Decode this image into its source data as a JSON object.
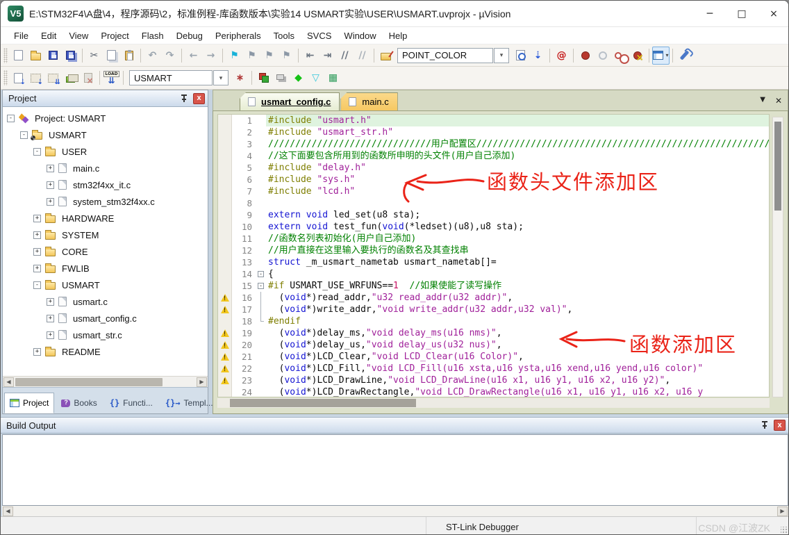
{
  "window": {
    "icon": "V5",
    "title": "E:\\STM32F4\\A盘\\4，程序源码\\2，标准例程-库函数版本\\实验14 USMART实验\\USER\\USMART.uvprojx - µVision",
    "controls": {
      "minimize": "─",
      "maximize": "□",
      "close": "×"
    }
  },
  "menu": {
    "items": [
      "File",
      "Edit",
      "View",
      "Project",
      "Flash",
      "Debug",
      "Peripherals",
      "Tools",
      "SVCS",
      "Window",
      "Help"
    ]
  },
  "toolbar_main": {
    "find_value": "POINT_COLOR",
    "items": [
      {
        "t": "i",
        "n": "new-file",
        "s": "s-page"
      },
      {
        "t": "i",
        "n": "open-file",
        "s": "s-folder"
      },
      {
        "t": "i",
        "n": "save",
        "s": "s-disk"
      },
      {
        "t": "i",
        "n": "save-all",
        "s": "s-disk s-disks"
      },
      {
        "t": "sep"
      },
      {
        "t": "i",
        "n": "cut",
        "g": "✂",
        "c": "#5a6470"
      },
      {
        "t": "i",
        "n": "copy",
        "s": "s-page s-copy"
      },
      {
        "t": "i",
        "n": "paste",
        "s": "s-clip"
      },
      {
        "t": "sep"
      },
      {
        "t": "i",
        "n": "undo",
        "g": "↶",
        "c": "#9aa4ae"
      },
      {
        "t": "i",
        "n": "redo",
        "g": "↷",
        "c": "#9aa4ae"
      },
      {
        "t": "sep"
      },
      {
        "t": "i",
        "n": "navigate-back",
        "g": "←",
        "c": "#9aa4ae"
      },
      {
        "t": "i",
        "n": "navigate-forward",
        "g": "→",
        "c": "#9aa4ae"
      },
      {
        "t": "sep"
      },
      {
        "t": "i",
        "n": "insert-bookmark",
        "g": "⚑",
        "c": "#18b2d8"
      },
      {
        "t": "i",
        "n": "next-bookmark",
        "g": "⚑",
        "c": "#8c98a6"
      },
      {
        "t": "i",
        "n": "previous-bookmark",
        "g": "⚑",
        "c": "#8c98a6"
      },
      {
        "t": "i",
        "n": "clear-bookmarks",
        "g": "⚑",
        "c": "#8c98a6"
      },
      {
        "t": "sep"
      },
      {
        "t": "i",
        "n": "unindent",
        "g": "⇤",
        "c": "#68727e"
      },
      {
        "t": "i",
        "n": "indent",
        "g": "⇥",
        "c": "#68727e"
      },
      {
        "t": "i",
        "n": "comment-selection",
        "g": "//",
        "c": "#68727e"
      },
      {
        "t": "i",
        "n": "uncomment-selection",
        "g": "//",
        "c": "#a8b0b8"
      },
      {
        "t": "sep"
      },
      {
        "t": "i",
        "n": "find-in-files",
        "s": "s-book"
      },
      {
        "t": "find"
      },
      {
        "t": "dd",
        "n": "find-dropdown"
      },
      {
        "t": "i",
        "n": "find-in-files-dialog",
        "s": "s-findpage"
      },
      {
        "t": "i",
        "n": "incremental-find",
        "g": "⇣",
        "c": "#2858d8"
      },
      {
        "t": "sep"
      },
      {
        "t": "i",
        "n": "find-text",
        "g": "@",
        "c": "#c41818"
      },
      {
        "t": "sep"
      },
      {
        "t": "i",
        "n": "insert-breakpoint",
        "s": "s-bp"
      },
      {
        "t": "i",
        "n": "enable-disable-breakpoint",
        "s": "s-bpo"
      },
      {
        "t": "i",
        "n": "disable-all-breakpoints",
        "s": "s-bp2"
      },
      {
        "t": "i",
        "n": "kill-all-breakpoints",
        "s": "s-bpx"
      },
      {
        "t": "sep"
      },
      {
        "t": "i",
        "n": "window-views",
        "s": "s-win",
        "pressed": true,
        "dd": true
      },
      {
        "t": "sep"
      },
      {
        "t": "i",
        "n": "configure",
        "s": "s-wrench"
      }
    ]
  },
  "toolbar_build": {
    "target_value": "USMART",
    "items": [
      {
        "t": "i",
        "n": "translate",
        "s": "s-page",
        "ov": "⇣",
        "oc": "#2858d8"
      },
      {
        "t": "i",
        "n": "build",
        "s": "s-build",
        "ov": "⇣",
        "oc": "#2858d8"
      },
      {
        "t": "i",
        "n": "rebuild-all",
        "s": "s-build",
        "ov": "⇊",
        "oc": "#2858d8"
      },
      {
        "t": "i",
        "n": "batch-build",
        "s": "s-batch"
      },
      {
        "t": "i",
        "n": "stop-build",
        "s": "s-stop"
      },
      {
        "t": "sep"
      },
      {
        "t": "i",
        "n": "download",
        "s": "s-load",
        "g": "⇊",
        "c": "#2353c4",
        "lbl": "LOAD"
      },
      {
        "t": "sep"
      },
      {
        "t": "target"
      },
      {
        "t": "dd",
        "n": "target-dropdown"
      },
      {
        "t": "i",
        "n": "target-options",
        "g": "∗",
        "c": "#b03838"
      },
      {
        "t": "sep"
      },
      {
        "t": "i",
        "n": "manage-project-items",
        "s": "s-cube"
      },
      {
        "t": "i",
        "n": "manage-multi-project",
        "s": "s-layers"
      },
      {
        "t": "i",
        "n": "functions-window",
        "g": "◆",
        "c": "#16c216"
      },
      {
        "t": "i",
        "n": "templates-window",
        "g": "▽",
        "c": "#38c8dc"
      },
      {
        "t": "i",
        "n": "source-browser",
        "g": "▦",
        "c": "#2a9a58"
      }
    ]
  },
  "project_panel": {
    "title": "Project",
    "tree": [
      {
        "level": 0,
        "icon": "target",
        "label": "Project: USMART",
        "expand": "minus"
      },
      {
        "level": 1,
        "icon": "folder-open",
        "gear": true,
        "label": "USMART",
        "expand": "minus"
      },
      {
        "level": 2,
        "icon": "folder-open",
        "label": "USER",
        "expand": "minus"
      },
      {
        "level": 3,
        "icon": "file",
        "label": "main.c",
        "expand": "plus"
      },
      {
        "level": 3,
        "icon": "file",
        "label": "stm32f4xx_it.c",
        "expand": "plus"
      },
      {
        "level": 3,
        "icon": "file",
        "label": "system_stm32f4xx.c",
        "expand": "plus"
      },
      {
        "level": 2,
        "icon": "folder",
        "label": "HARDWARE",
        "expand": "plus"
      },
      {
        "level": 2,
        "icon": "folder",
        "label": "SYSTEM",
        "expand": "plus"
      },
      {
        "level": 2,
        "icon": "folder",
        "label": "CORE",
        "expand": "plus"
      },
      {
        "level": 2,
        "icon": "folder",
        "label": "FWLIB",
        "expand": "plus"
      },
      {
        "level": 2,
        "icon": "folder-open",
        "label": "USMART",
        "expand": "minus"
      },
      {
        "level": 3,
        "icon": "file",
        "label": "usmart.c",
        "expand": "plus"
      },
      {
        "level": 3,
        "icon": "file",
        "label": "usmart_config.c",
        "expand": "plus"
      },
      {
        "level": 3,
        "icon": "file",
        "label": "usmart_str.c",
        "expand": "plus"
      },
      {
        "level": 2,
        "icon": "folder",
        "label": "README",
        "expand": "plus"
      }
    ],
    "tabs": [
      {
        "key": "project",
        "label": "Project",
        "active": true
      },
      {
        "key": "books",
        "label": "Books"
      },
      {
        "key": "functions",
        "label": "Functi..."
      },
      {
        "key": "templates",
        "label": "Templ..."
      }
    ]
  },
  "editor": {
    "tabs": [
      {
        "label": "usmart_config.c",
        "active": true
      },
      {
        "label": "main.c",
        "active": false
      }
    ],
    "lines": [
      {
        "n": 1,
        "hl": true,
        "segs": [
          [
            "pp",
            "#include "
          ],
          [
            "str",
            "\"usmart.h\""
          ]
        ]
      },
      {
        "n": 2,
        "segs": [
          [
            "pp",
            "#include "
          ],
          [
            "str",
            "\"usmart_str.h\""
          ]
        ]
      },
      {
        "n": 3,
        "segs": [
          [
            "com",
            "//////////////////////////////用户配置区////////////////////////////////////////////////////////////////////////////"
          ]
        ]
      },
      {
        "n": 4,
        "segs": [
          [
            "com",
            "//这下面要包含所用到的函数所申明的头文件(用户自己添加)"
          ]
        ]
      },
      {
        "n": 5,
        "segs": [
          [
            "pp",
            "#include "
          ],
          [
            "str",
            "\"delay.h\""
          ]
        ]
      },
      {
        "n": 6,
        "segs": [
          [
            "pp",
            "#include "
          ],
          [
            "str",
            "\"sys.h\""
          ]
        ]
      },
      {
        "n": 7,
        "segs": [
          [
            "pp",
            "#include "
          ],
          [
            "str",
            "\"lcd.h\""
          ]
        ]
      },
      {
        "n": 8,
        "segs": []
      },
      {
        "n": 9,
        "segs": [
          [
            "kw",
            "extern"
          ],
          [
            "pl",
            " "
          ],
          [
            "kw",
            "void"
          ],
          [
            "pl",
            " led_set(u8 sta);"
          ]
        ]
      },
      {
        "n": 10,
        "segs": [
          [
            "kw",
            "extern"
          ],
          [
            "pl",
            " "
          ],
          [
            "kw",
            "void"
          ],
          [
            "pl",
            " test_fun("
          ],
          [
            "kw",
            "void"
          ],
          [
            "pl",
            "(*ledset)(u8),u8 sta);"
          ]
        ]
      },
      {
        "n": 11,
        "segs": [
          [
            "com",
            "//函数名列表初始化(用户自己添加)"
          ]
        ]
      },
      {
        "n": 12,
        "segs": [
          [
            "com",
            "//用户直接在这里输入要执行的函数名及其查找串"
          ]
        ]
      },
      {
        "n": 13,
        "segs": [
          [
            "kw",
            "struct"
          ],
          [
            "pl",
            " _m_usmart_nametab usmart_nametab[]="
          ]
        ]
      },
      {
        "n": 14,
        "fold": "box",
        "segs": [
          [
            "pl",
            "{"
          ]
        ]
      },
      {
        "n": 15,
        "fold": "box",
        "segs": [
          [
            "pp",
            "#if"
          ],
          [
            "pl",
            " USMART_USE_WRFUNS=="
          ],
          [
            "num",
            "1"
          ],
          [
            "pl",
            "  "
          ],
          [
            "com",
            "//如果使能了读写操作"
          ]
        ]
      },
      {
        "n": 16,
        "warn": true,
        "fold": "line",
        "segs": [
          [
            "pl",
            "  ("
          ],
          [
            "kw",
            "void"
          ],
          [
            "pl",
            "*)read_addr,"
          ],
          [
            "str",
            "\"u32 read_addr(u32 addr)\""
          ],
          [
            "pl",
            ","
          ]
        ]
      },
      {
        "n": 17,
        "warn": true,
        "fold": "line",
        "segs": [
          [
            "pl",
            "  ("
          ],
          [
            "kw",
            "void"
          ],
          [
            "pl",
            "*)write_addr,"
          ],
          [
            "str",
            "\"void write_addr(u32 addr,u32 val)\""
          ],
          [
            "pl",
            ","
          ]
        ]
      },
      {
        "n": 18,
        "fold": "end",
        "segs": [
          [
            "pp",
            "#endif"
          ]
        ]
      },
      {
        "n": 19,
        "warn": true,
        "segs": [
          [
            "pl",
            "  ("
          ],
          [
            "kw",
            "void"
          ],
          [
            "pl",
            "*)delay_ms,"
          ],
          [
            "str",
            "\"void delay_ms(u16 nms)\""
          ],
          [
            "pl",
            ","
          ]
        ]
      },
      {
        "n": 20,
        "warn": true,
        "segs": [
          [
            "pl",
            "  ("
          ],
          [
            "kw",
            "void"
          ],
          [
            "pl",
            "*)delay_us,"
          ],
          [
            "str",
            "\"void delay_us(u32 nus)\""
          ],
          [
            "pl",
            ","
          ]
        ]
      },
      {
        "n": 21,
        "warn": true,
        "segs": [
          [
            "pl",
            "  ("
          ],
          [
            "kw",
            "void"
          ],
          [
            "pl",
            "*)LCD_Clear,"
          ],
          [
            "str",
            "\"void LCD_Clear(u16 Color)\""
          ],
          [
            "pl",
            ","
          ]
        ]
      },
      {
        "n": 22,
        "warn": true,
        "segs": [
          [
            "pl",
            "  ("
          ],
          [
            "kw",
            "void"
          ],
          [
            "pl",
            "*)LCD_Fill,"
          ],
          [
            "str",
            "\"void LCD_Fill(u16 xsta,u16 ysta,u16 xend,u16 yend,u16 color)\""
          ]
        ]
      },
      {
        "n": 23,
        "warn": true,
        "segs": [
          [
            "pl",
            "  ("
          ],
          [
            "kw",
            "void"
          ],
          [
            "pl",
            "*)LCD_DrawLine,"
          ],
          [
            "str",
            "\"void LCD_DrawLine(u16 x1, u16 y1, u16 x2, u16 y2)\""
          ],
          [
            "pl",
            ","
          ]
        ]
      },
      {
        "n": 24,
        "segs": [
          [
            "pl",
            "  ("
          ],
          [
            "kw",
            "void"
          ],
          [
            "pl",
            "*)LCD_DrawRectangle,"
          ],
          [
            "str",
            "\"void LCD_DrawRectangle(u16 x1, u16 y1, u16 x2, u16 y"
          ]
        ]
      }
    ]
  },
  "annotations": [
    {
      "text": "函数头文件添加区"
    },
    {
      "text": "函数添加区"
    }
  ],
  "build_output": {
    "title": "Build Output",
    "content": ""
  },
  "status_bar": {
    "debugger": "ST-Link Debugger",
    "watermark": "CSDN @江波ZK"
  },
  "colors": {
    "annotation_red": "#ea2318",
    "line_highlight": "#dff3df",
    "inactive_tab_orange": "#f6c863",
    "breakpoint_red": "#b8392e",
    "comment_green": "#008000",
    "string_purple": "#a0209a",
    "keyword_blue": "#1414d2",
    "preprocessor_olive": "#7e7e00"
  }
}
